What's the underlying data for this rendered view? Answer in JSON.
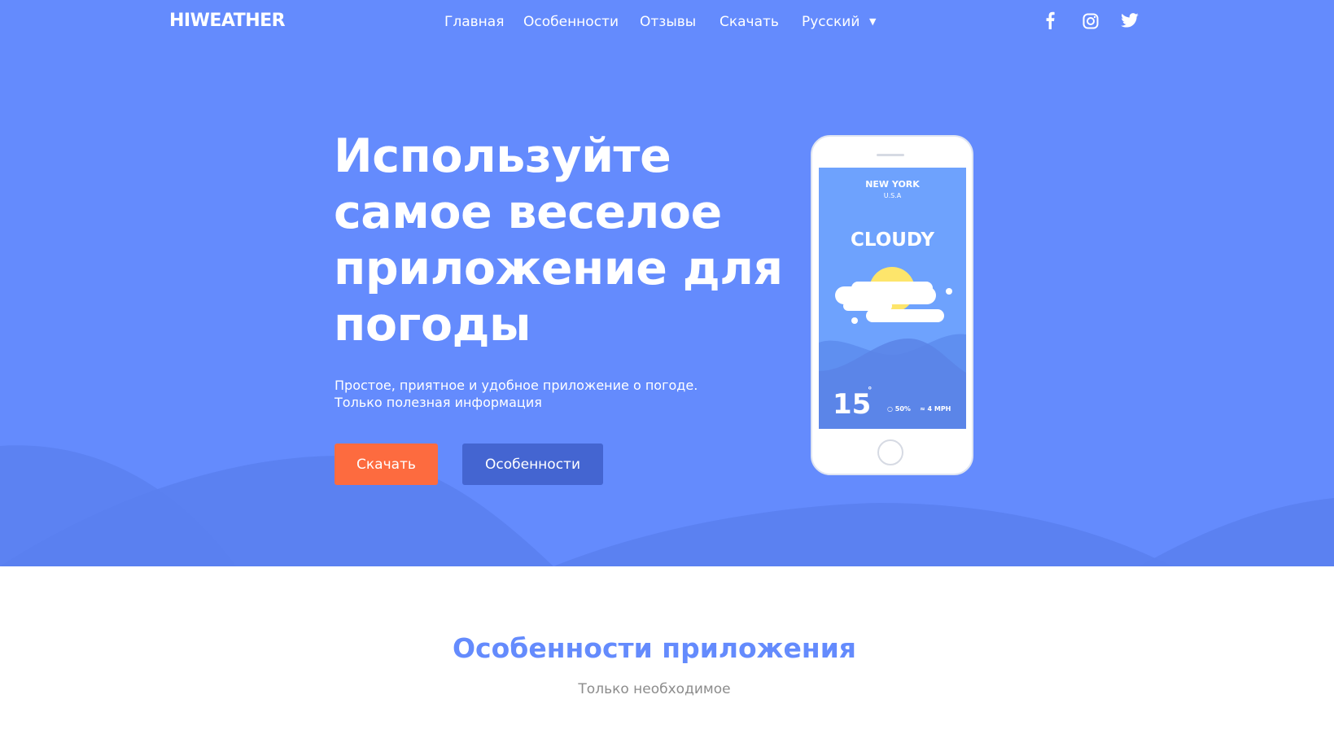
{
  "brand": {
    "logo": "HIWEATHER"
  },
  "nav": {
    "items": [
      "Главная",
      "Особенности",
      "Отзывы",
      "Скачать"
    ],
    "language": "Русский",
    "language_caret": "▼"
  },
  "social": {
    "icons": [
      "facebook-icon",
      "instagram-icon",
      "twitter-icon"
    ]
  },
  "hero": {
    "headline": "Используйте самое веселое приложение для погоды",
    "subtitle_line1": "Простое, приятное и удобное приложение о погоде.",
    "subtitle_line2": "Только полезная информация",
    "download_button": "Скачать",
    "features_button": "Особенности"
  },
  "phone": {
    "city": "NEW YORK",
    "country": "U.S.A",
    "condition": "CLOUDY",
    "temperature": "15",
    "degree": "°",
    "humidity": "50%",
    "wind": "4 MPH"
  },
  "features": {
    "title": "Особенности приложения",
    "subtitle": "Только необходимое"
  },
  "colors": {
    "hero_bg": "#648bfd",
    "download_button": "#fd6b3f",
    "features_button": "#4465d1",
    "sun": "#fde56b",
    "section_title": "#648bfd"
  }
}
